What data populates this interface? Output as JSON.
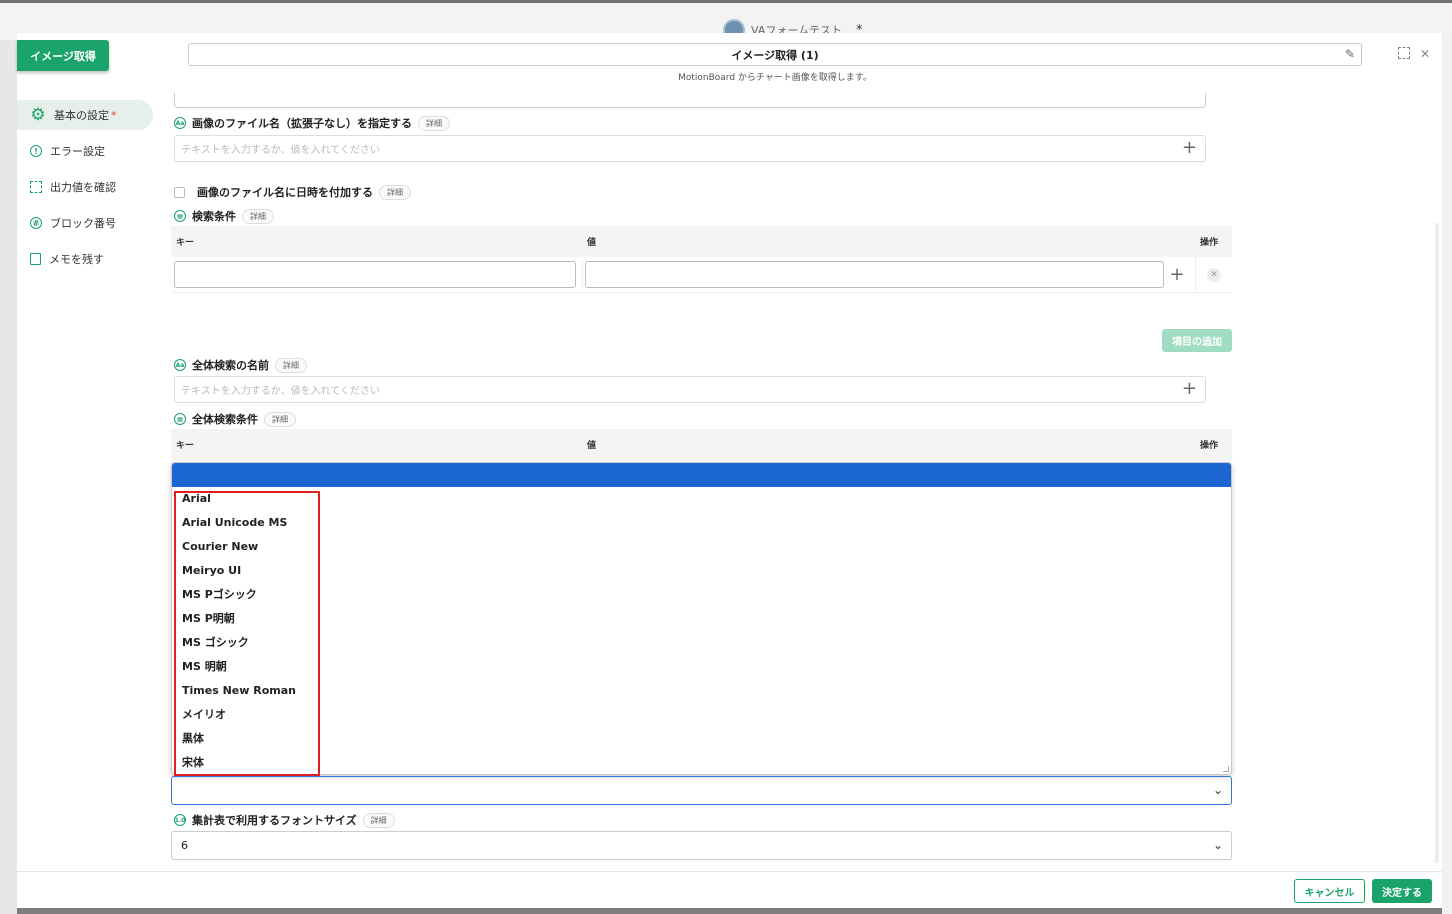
{
  "app": {
    "title": "VAフォームテスト",
    "modified_mark": "*"
  },
  "header": {
    "block_button": "イメージ取得",
    "title": "イメージ取得 (1)",
    "subtitle": "MotionBoard からチャート画像を取得します。"
  },
  "sidebar": {
    "items": [
      {
        "label": "基本の設定",
        "required": "*",
        "icon": "gear-icon"
      },
      {
        "label": "エラー設定",
        "icon": "error-icon"
      },
      {
        "label": "出力値を確認",
        "icon": "bracket-icon"
      },
      {
        "label": "ブロック番号",
        "icon": "block-number-icon"
      },
      {
        "label": "メモを残す",
        "icon": "note-icon"
      }
    ]
  },
  "form": {
    "filename": {
      "label": "画像のファイル名（拡張子なし）を指定する",
      "detail": "詳細",
      "placeholder": "テキストを入力するか、値を入れてください"
    },
    "append_date": {
      "label": "画像のファイル名に日時を付加する",
      "detail": "詳細"
    },
    "search": {
      "label": "検索条件",
      "detail": "詳細",
      "col_key": "キー",
      "col_value": "値",
      "col_op": "操作",
      "add_button": "項目の追加"
    },
    "global_name": {
      "label": "全体検索の名前",
      "detail": "詳細",
      "placeholder": "テキストを入力するか、値を入れてください"
    },
    "global_search": {
      "label": "全体検索条件",
      "detail": "詳細",
      "col_key": "キー",
      "col_value": "値",
      "col_op": "操作"
    },
    "font_size": {
      "label": "集計表で利用するフォントサイズ",
      "detail": "詳細",
      "value": "6"
    }
  },
  "font_dropdown": {
    "options": [
      "Arial",
      "Arial Unicode MS",
      "Courier New",
      "Meiryo UI",
      "MS Pゴシック",
      "MS P明朝",
      "MS ゴシック",
      "MS 明朝",
      "Times New Roman",
      "メイリオ",
      "黒体",
      "宋体"
    ],
    "selected": ""
  },
  "footer": {
    "cancel": "キャンセル",
    "confirm": "決定する"
  },
  "colors": {
    "accent": "#1aa36b",
    "highlight": "#1c66d2",
    "annotation": "#e02020"
  }
}
